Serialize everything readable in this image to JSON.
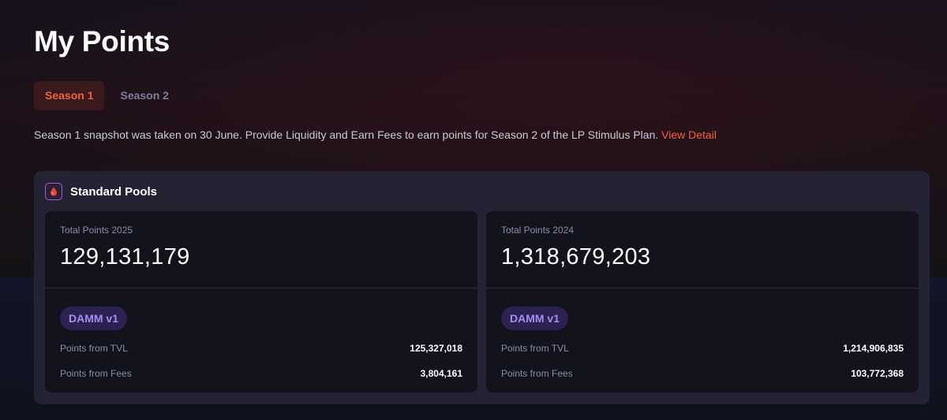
{
  "page": {
    "title": "My Points"
  },
  "tabs": [
    {
      "label": "Season 1",
      "active": true
    },
    {
      "label": "Season 2",
      "active": false
    }
  ],
  "notice": {
    "text": "Season 1 snapshot was taken on 30 June. Provide Liquidity and Earn Fees to earn points for Season 2 of the LP Stimulus Plan.",
    "link": "View Detail"
  },
  "panel": {
    "title": "Standard Pools",
    "icon": "droplet-icon",
    "cards": [
      {
        "label": "Total Points 2025",
        "value": "129,131,179",
        "badge": "DAMM v1",
        "rows": [
          {
            "label": "Points from TVL",
            "value": "125,327,018"
          },
          {
            "label": "Points from Fees",
            "value": "3,804,161"
          }
        ]
      },
      {
        "label": "Total Points 2024",
        "value": "1,318,679,203",
        "badge": "DAMM v1",
        "rows": [
          {
            "label": "Points from TVL",
            "value": "1,214,906,835"
          },
          {
            "label": "Points from Fees",
            "value": "103,772,368"
          }
        ]
      }
    ]
  },
  "colors": {
    "accent": "#f0623a",
    "badge_text": "#a98cf2",
    "badge_bg": "#2c2252",
    "panel_bg": "#232334",
    "card_bg": "#13131d"
  }
}
